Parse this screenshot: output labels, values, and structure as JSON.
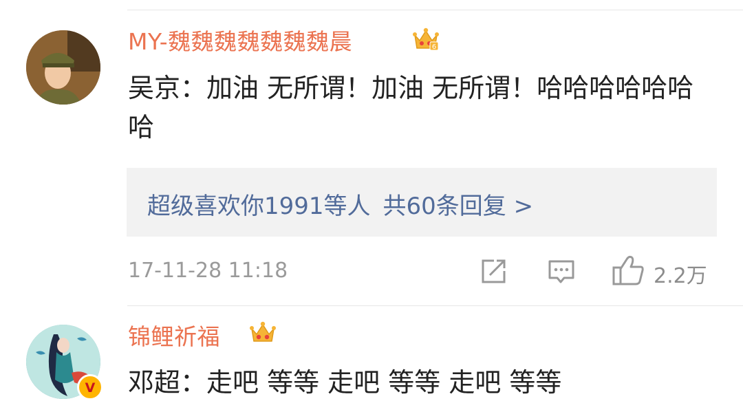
{
  "comments": [
    {
      "username": "MY-魏魏魏魏魏魏魏晨",
      "badge_icon": "crown-level-6-icon",
      "badge_level": "6",
      "text": "吴京：加油 无所谓！加油 无所谓！哈哈哈哈哈哈哈",
      "replies": {
        "summary": "超级喜欢你1991等人",
        "count_label": "共60条回复 >"
      },
      "timestamp": "17-11-28 11:18",
      "actions": {
        "share_icon": "share-icon",
        "comment_icon": "comment-icon",
        "like_icon": "thumbs-up-icon",
        "like_count": "2.2万"
      }
    },
    {
      "username": "锦鲤祈福",
      "badge_icon": "crown-icon",
      "verified_icon": "verified-v-badge-icon",
      "verified_label": "V",
      "text": "邓超：走吧 等等 走吧 等等 走吧 等等"
    }
  ],
  "colors": {
    "username": "#eb7350",
    "link": "#516b9a",
    "meta": "#9a9a9a",
    "reply_bg": "#f2f2f2",
    "divider": "#e6e6e6"
  }
}
